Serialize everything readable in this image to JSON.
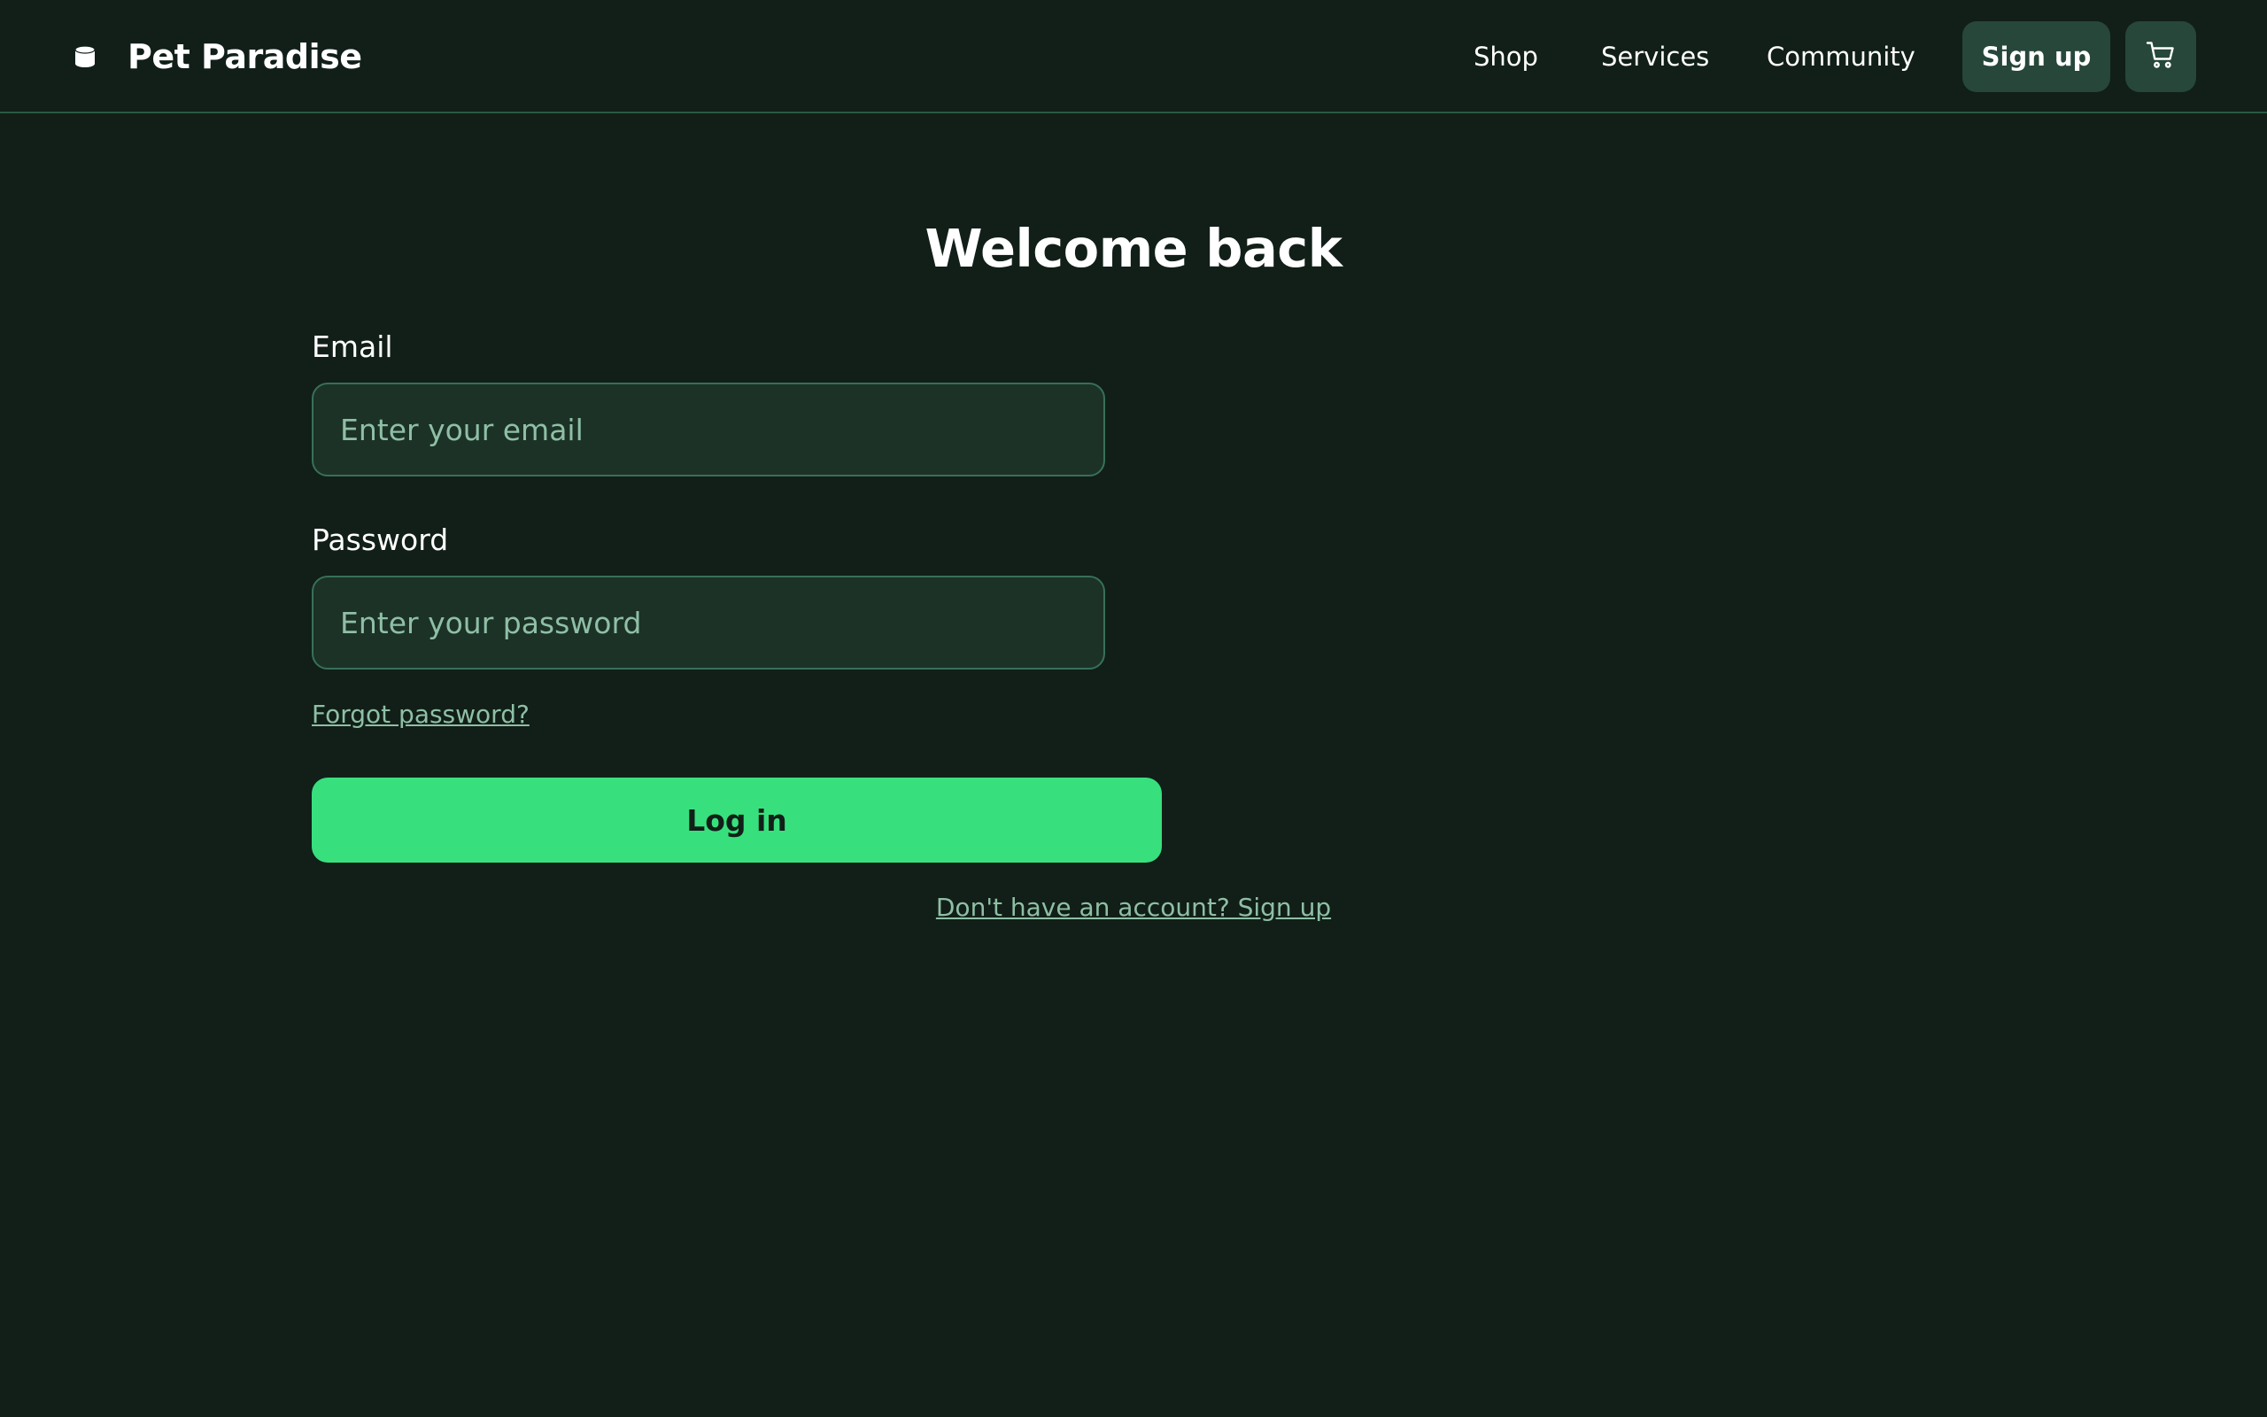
{
  "header": {
    "brand_name": "Pet Paradise",
    "brand_icon": "database-icon",
    "nav": [
      {
        "label": "Shop"
      },
      {
        "label": "Services"
      },
      {
        "label": "Community"
      }
    ],
    "signup_label": "Sign up",
    "cart_icon": "shopping-cart-icon"
  },
  "login": {
    "title": "Welcome back",
    "email_label": "Email",
    "email_placeholder": "Enter your email",
    "email_value": "",
    "password_label": "Password",
    "password_placeholder": "Enter your password",
    "password_value": "",
    "forgot_label": "Forgot password?",
    "submit_label": "Log in",
    "signup_prompt": "Don't have an account? Sign up"
  },
  "colors": {
    "background": "#111f18",
    "surface": "#1c3227",
    "button_secondary": "#26473a",
    "accent": "#38e07d",
    "muted_text": "#8fbfa5",
    "border": "#38705a"
  }
}
